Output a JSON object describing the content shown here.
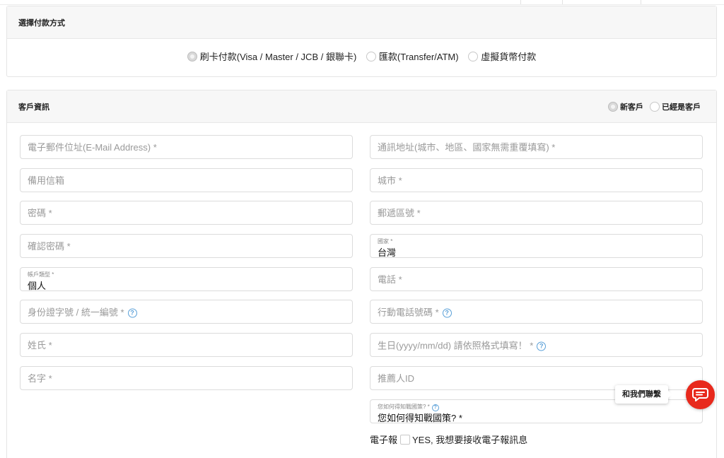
{
  "payment": {
    "title": "選擇付款方式",
    "options": [
      {
        "label": "刷卡付款(Visa / Master / JCB / 銀聯卡)",
        "selected": true
      },
      {
        "label": "匯款(Transfer/ATM)",
        "selected": false
      },
      {
        "label": "虛擬貨幣付款",
        "selected": false
      }
    ]
  },
  "customer": {
    "title": "客戶資訊",
    "type_options": [
      {
        "label": "新客戶",
        "selected": true
      },
      {
        "label": "已經是客戶",
        "selected": false
      }
    ],
    "left_fields": {
      "email": {
        "placeholder": "電子郵件位址(E-Mail Address) *"
      },
      "backup_email": {
        "placeholder": "備用信箱"
      },
      "password": {
        "placeholder": "密碼 *"
      },
      "confirm_password": {
        "placeholder": "確認密碼 *"
      },
      "account_type": {
        "label": "帳戶類型 *",
        "value": "個人"
      },
      "id_number": {
        "placeholder": "身份證字號 / 統一編號 *"
      },
      "last_name": {
        "placeholder": "姓氏 *"
      },
      "first_name": {
        "placeholder": "名字 *"
      }
    },
    "right_fields": {
      "address": {
        "placeholder": "通訊地址(城市、地區、國家無需重覆填寫) *"
      },
      "city": {
        "placeholder": "城市 *"
      },
      "postal_code": {
        "placeholder": "郵遞區號 *"
      },
      "country": {
        "label": "國家 *",
        "value": "台灣"
      },
      "phone": {
        "placeholder": "電話 *"
      },
      "mobile": {
        "placeholder": "行動電話號碼 *"
      },
      "birthday": {
        "placeholder": "生日(yyyy/mm/dd) 請依照格式填寫！ *"
      },
      "referrer": {
        "placeholder": "推薦人ID"
      },
      "source": {
        "label": "您如何得知戰國策? *",
        "value": "您如何得知戰國策? *"
      }
    },
    "newsletter": {
      "label": "電子報",
      "checkbox_label": "YES, 我想要接收電子報訊息",
      "checked": false
    }
  },
  "contact": {
    "tooltip": "和我們聯繫"
  },
  "icons": {
    "help": "?",
    "chat": "chat-bubble-icon"
  },
  "colors": {
    "chat_button": "#e8291c",
    "help_icon": "#5aa0d8"
  }
}
